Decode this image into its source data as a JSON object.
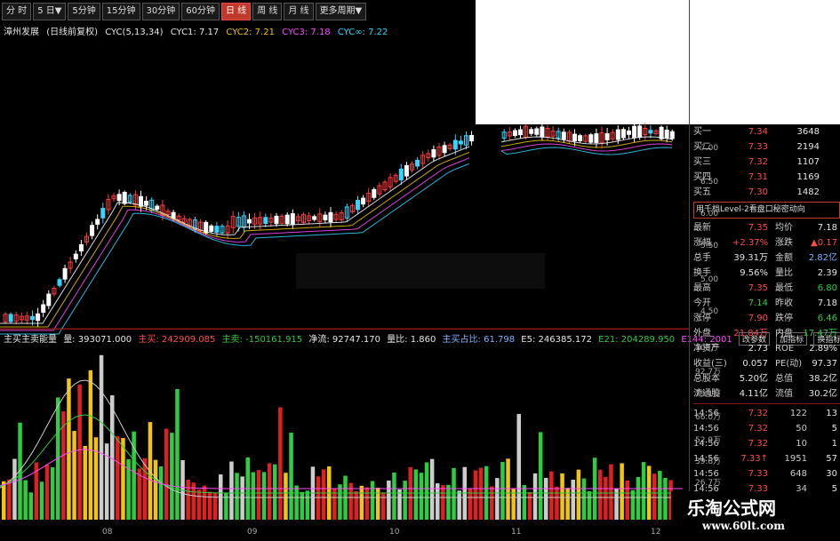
{
  "toolbar": {
    "tabs": [
      "分 时",
      "5 日▼",
      "5分钟",
      "15分钟",
      "30分钟",
      "60分钟",
      "日 线",
      "周 线",
      "月 线",
      "更多周期▼"
    ],
    "active_index": 6
  },
  "chart_header": {
    "name": "漳州发展",
    "mode": "(日线前复权)",
    "indicator": "CYC(5,13,34)",
    "cyc1": "CYC1: 7.17",
    "cyc2": "CYC2: 7.21",
    "cyc3": "CYC3: 7.18",
    "cycinf": "CYC∞: 7.22"
  },
  "price_axis": [
    "7.00",
    "6.50",
    "6.00",
    "5.50",
    "5.00",
    "4.50"
  ],
  "volume_header": {
    "name": "主买主卖能量",
    "vol": "量: 393071.000",
    "buy": "主买: 242909.085",
    "sell": "主卖: -150161.915",
    "net": "净流: 92747.170",
    "ratio": "量比: 1.860",
    "buy_pct": "主买占比: 61.798",
    "e5": "E5: 246385.172",
    "e21": "E21: 204289.950",
    "e144": "E144: 2001",
    "btn1": "改参数",
    "btn2": "加指标",
    "btn3": "换指标"
  },
  "volume_axis": [
    "108万",
    "92.7万",
    "79.1万",
    "66.0万",
    "52.9万",
    "39.8万",
    "26.7万"
  ],
  "date_axis": [
    "08",
    "09",
    "10",
    "11",
    "12"
  ],
  "order_book": [
    {
      "label": "买一",
      "price": "7.34",
      "vol": "3648"
    },
    {
      "label": "买二",
      "price": "7.33",
      "vol": "2194"
    },
    {
      "label": "买三",
      "price": "7.32",
      "vol": "1107"
    },
    {
      "label": "买四",
      "price": "7.31",
      "vol": "1169"
    },
    {
      "label": "买五",
      "price": "7.30",
      "vol": "1482"
    }
  ],
  "level2_banner": "用千档Level-2看盘口秘密动向",
  "stats": [
    {
      "l1": "最新",
      "v1": "7.35",
      "l2": "均价",
      "v2": "7.18",
      "c1": "red",
      "c2": "white"
    },
    {
      "l1": "涨幅",
      "v1": "+2.37%",
      "l2": "涨跌",
      "v2": "▲0.17",
      "c1": "red",
      "c2": "red"
    },
    {
      "l1": "总手",
      "v1": "39.31万",
      "l2": "金额",
      "v2": "2.82亿",
      "c1": "white",
      "c2": "blue"
    },
    {
      "l1": "换手",
      "v1": "9.56%",
      "l2": "量比",
      "v2": "2.39",
      "c1": "white",
      "c2": "white"
    },
    {
      "l1": "最高",
      "v1": "7.35",
      "l2": "最低",
      "v2": "6.80",
      "c1": "red",
      "c2": "green"
    },
    {
      "l1": "今开",
      "v1": "7.14",
      "l2": "昨收",
      "v2": "7.18",
      "c1": "green",
      "c2": "white"
    },
    {
      "l1": "涨停",
      "v1": "7.90",
      "l2": "跌停",
      "v2": "6.46",
      "c1": "red",
      "c2": "green"
    },
    {
      "l1": "外盘",
      "v1": "21.84万",
      "l2": "内盘",
      "v2": "17.47万",
      "c1": "red",
      "c2": "green"
    },
    {
      "l1": "净资产",
      "v1": "2.73",
      "l2": "ROE",
      "v2": "2.89%",
      "c1": "white",
      "c2": "white"
    },
    {
      "l1": "收益(三)",
      "v1": "0.057",
      "l2": "PE(动)",
      "v2": "97.37",
      "c1": "white",
      "c2": "white"
    },
    {
      "l1": "总股本",
      "v1": "5.20亿",
      "l2": "总值",
      "v2": "38.2亿",
      "c1": "white",
      "c2": "white"
    },
    {
      "l1": "流通股",
      "v1": "4.11亿",
      "l2": "流值",
      "v2": "30.2亿",
      "c1": "white",
      "c2": "white"
    }
  ],
  "ticks": [
    {
      "time": "14:56",
      "price": "7.32",
      "vol": "122",
      "n": "13",
      "vc": "green"
    },
    {
      "time": "14:56",
      "price": "7.32",
      "vol": "50",
      "n": "5",
      "vc": "green"
    },
    {
      "time": "14:56",
      "price": "7.32",
      "vol": "10",
      "n": "1",
      "vc": "green"
    },
    {
      "time": "14:56",
      "price": "7.33↑",
      "vol": "1951",
      "n": "57",
      "vc": "red"
    },
    {
      "time": "14:56",
      "price": "7.33",
      "vol": "648",
      "n": "30",
      "vc": "red"
    },
    {
      "time": "14:56",
      "price": "7.33",
      "vol": "34",
      "n": "5",
      "vc": "green"
    }
  ],
  "watermark": {
    "line1": "乐淘公式网",
    "line2": "www.60lt.com"
  },
  "colors": {
    "up": "#ff3b3b",
    "down": "#2ecc40",
    "flat": "#33d6ff",
    "accent": "#c0392b"
  }
}
